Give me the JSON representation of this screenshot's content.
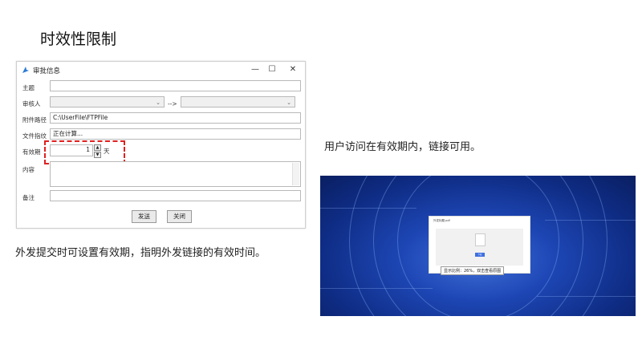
{
  "slide": {
    "title": "时效性限制"
  },
  "dialog": {
    "title": "审批信息",
    "window_controls": {
      "minimize": "—",
      "maximize": "☐",
      "close": "✕"
    },
    "fields": {
      "subject_label": "主题",
      "subject_value": "",
      "approver_label": "审核人",
      "approver_from": "",
      "approver_arrow": "-->",
      "approver_to": "",
      "attachment_label": "附件路径",
      "attachment_value": "C:\\UserFile\\FTPFile",
      "fingerprint_label": "文件指纹",
      "fingerprint_value": "正在计算...",
      "validity_label": "有效期",
      "validity_value": "1",
      "validity_unit": "天",
      "content_label": "内容",
      "content_value": "",
      "remark_label": "备注",
      "remark_value": ""
    },
    "buttons": {
      "send": "发送",
      "close": "关闭"
    }
  },
  "captions": {
    "left": "外发提交时可设置有效期，指明外发链接的有效时间。",
    "right": "用户访问在有效期内，链接可用。"
  },
  "screenshot": {
    "card_title": "外发标题.pdf",
    "card_sub": "",
    "file_name": "",
    "download_label": "下载",
    "tooltip": "显示比例：26%，双击查看原图"
  },
  "colors": {
    "highlight": "#e02020",
    "accent": "#3d6fe0",
    "background_blue": "#1d46b4"
  },
  "icons": [
    "app-icon",
    "dropdown-chevron-icon",
    "spinner-up-icon",
    "spinner-down-icon",
    "file-icon"
  ]
}
